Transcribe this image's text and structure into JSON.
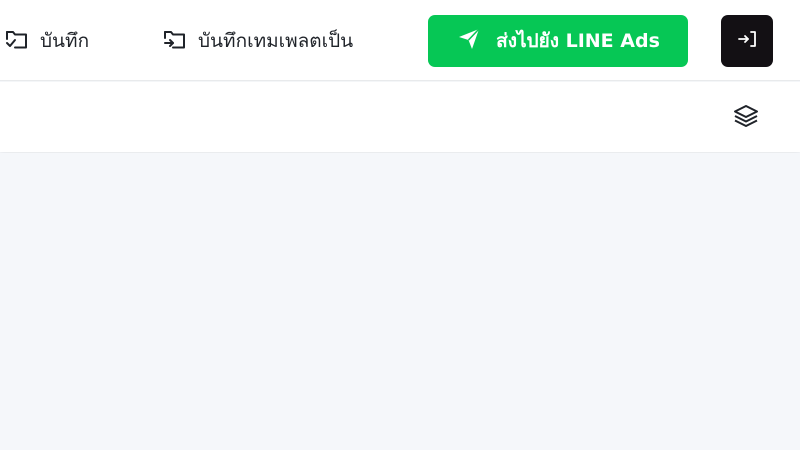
{
  "toolbar": {
    "save_label": "บันทึก",
    "save_template_label": "บันทึกเทมเพลตเป็น",
    "send_label": "ส่งไปยัง LINE Ads",
    "exit_icon": "exit-arrow-icon"
  },
  "subbar": {
    "layers_icon": "layers-icon"
  },
  "colors": {
    "send_button": "#06c755",
    "exit_button": "#131014",
    "canvas_background": "#f5f7fa"
  }
}
